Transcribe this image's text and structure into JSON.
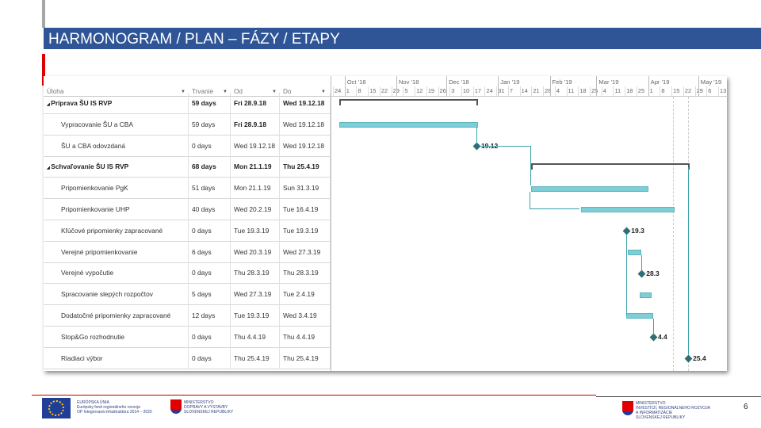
{
  "slide": {
    "title": "HARMONOGRAM / PLAN – FÁZY / ETAPY",
    "page_number": "6",
    "colors": {
      "title_bar": "#2f5597",
      "accent_red": "#e00000",
      "bar": "#7ccfd6"
    }
  },
  "table": {
    "columns": [
      "Úloha",
      "Trvanie",
      "Od",
      "Do"
    ],
    "rows": [
      {
        "name": "Príprava ŠU IS RVP",
        "duration": "59 days",
        "start": "Fri 28.9.18",
        "end": "Wed 19.12.18",
        "type": "summary"
      },
      {
        "name": "Vypracovanie ŠU a CBA",
        "duration": "59 days",
        "start": "Fri 28.9.18",
        "end": "Wed 19.12.18",
        "type": "task"
      },
      {
        "name": "ŠU a CBA odovzdaná",
        "duration": "0 days",
        "start": "Wed 19.12.18",
        "end": "Wed 19.12.18",
        "type": "milestone",
        "label": "19.12"
      },
      {
        "name": "Schvaľovanie ŠU IS RVP",
        "duration": "68 days",
        "start": "Mon 21.1.19",
        "end": "Thu 25.4.19",
        "type": "summary"
      },
      {
        "name": "Pripomienkovanie PgK",
        "duration": "51 days",
        "start": "Mon 21.1.19",
        "end": "Sun 31.3.19",
        "type": "task"
      },
      {
        "name": "Pripomienkovanie UHP",
        "duration": "40 days",
        "start": "Wed 20.2.19",
        "end": "Tue 16.4.19",
        "type": "task"
      },
      {
        "name": "Kľúčové pripomienky zapracované",
        "duration": "0 days",
        "start": "Tue 19.3.19",
        "end": "Tue 19.3.19",
        "type": "milestone",
        "label": "19.3"
      },
      {
        "name": "Verejné pripomienkovanie",
        "duration": "6 days",
        "start": "Wed 20.3.19",
        "end": "Wed 27.3.19",
        "type": "task"
      },
      {
        "name": "Verejné vypočutie",
        "duration": "0 days",
        "start": "Thu 28.3.19",
        "end": "Thu 28.3.19",
        "type": "milestone",
        "label": "28.3"
      },
      {
        "name": "Spracovanie slepých rozpočtov",
        "duration": "5 days",
        "start": "Wed 27.3.19",
        "end": "Tue 2.4.19",
        "type": "task"
      },
      {
        "name": "Dodatočné pripomienky zapracované",
        "duration": "12 days",
        "start": "Tue 19.3.19",
        "end": "Wed 3.4.19",
        "type": "task"
      },
      {
        "name": "Stop&Go rozhodnutie",
        "duration": "0 days",
        "start": "Thu 4.4.19",
        "end": "Thu 4.4.19",
        "type": "milestone",
        "label": "4.4"
      },
      {
        "name": "Riadiaci výbor",
        "duration": "0 days",
        "start": "Thu 25.4.19",
        "end": "Thu 25.4.19",
        "type": "milestone",
        "label": "25.4"
      }
    ]
  },
  "timeline": {
    "months": [
      "Oct '18",
      "Nov '18",
      "Dec '18",
      "Jan '19",
      "Feb '19",
      "Mar '19",
      "Apr '19",
      "May '19"
    ],
    "weeks": [
      "24",
      "1",
      "8",
      "15",
      "22",
      "29",
      "5",
      "12",
      "19",
      "26",
      "3",
      "10",
      "17",
      "24",
      "31",
      "7",
      "14",
      "21",
      "28",
      "4",
      "11",
      "18",
      "25",
      "4",
      "11",
      "18",
      "25",
      "1",
      "8",
      "15",
      "22",
      "29",
      "6",
      "13"
    ]
  },
  "footer": {
    "logo1": [
      "EURÓPSKA ÚNIA",
      "Európsky fond regionálneho rozvoja",
      "OP Integrovaná infraštruktúra 2014 – 2020"
    ],
    "logo2": [
      "MINISTERSTVO",
      "DOPRAVY A VÝSTAVBY",
      "SLOVENSKEJ REPUBLIKY"
    ],
    "logo3": [
      "MINISTERSTVO",
      "INVESTÍCIÍ, REGIONÁLNEHO ROZVOJA",
      "A INFORMATIZÁCIE",
      "SLOVENSKEJ REPUBLIKY"
    ]
  }
}
